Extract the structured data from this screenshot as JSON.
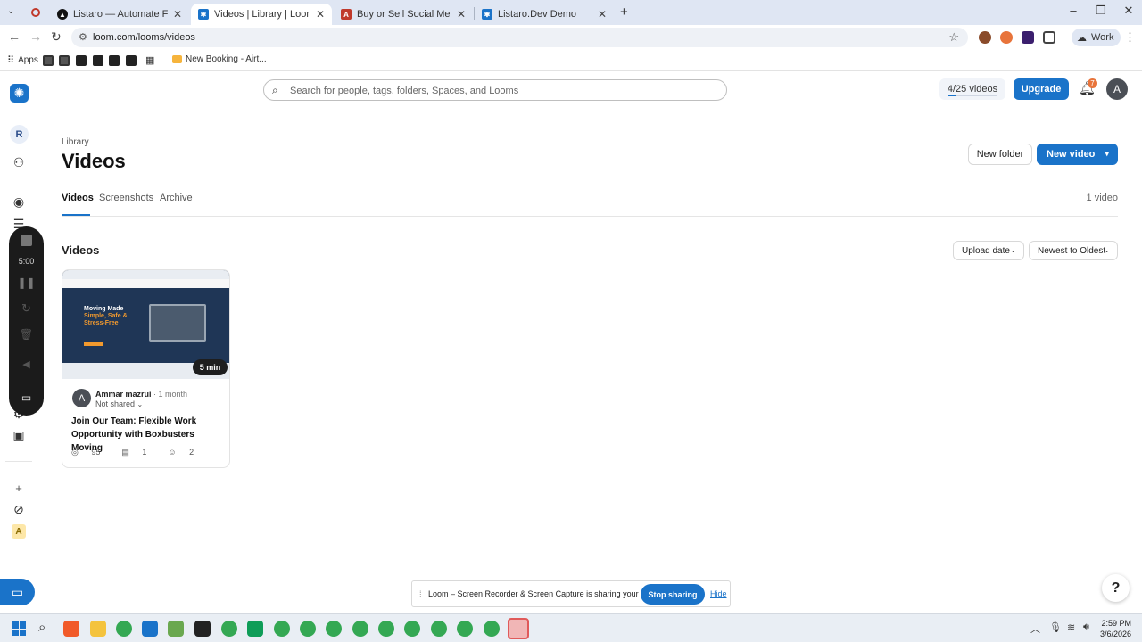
{
  "browser": {
    "tabs": [
      {
        "title": "Listaro — Automate Facebook",
        "active": false
      },
      {
        "title": "Videos | Library | Loom",
        "active": true
      },
      {
        "title": "Buy or Sell Social Media Accou",
        "active": false
      },
      {
        "title": "Listaro.Dev Demo",
        "active": false
      }
    ],
    "url": "loom.com/looms/videos",
    "profile_label": "Work",
    "bookmarks": {
      "apps_label": "Apps",
      "new_booking_label": "New Booking - Airt..."
    }
  },
  "rail": {
    "workspace_initial": "R",
    "member_initial": "A"
  },
  "recorder": {
    "timer": "5:00"
  },
  "header": {
    "search_placeholder": "Search for people, tags, folders, Spaces, and Looms",
    "quota_label": "4/25 videos",
    "quota_fraction": 0.16,
    "upgrade_label": "Upgrade",
    "notification_count": "7",
    "avatar_initial": "A"
  },
  "page": {
    "breadcrumb": "Library",
    "title": "Videos",
    "new_folder_label": "New folder",
    "new_video_label": "New video",
    "tabs": [
      {
        "label": "Videos",
        "active": true
      },
      {
        "label": "Screenshots",
        "active": false
      },
      {
        "label": "Archive",
        "active": false
      }
    ],
    "video_count": "1 video",
    "section_title": "Videos",
    "sort_field": "Upload date",
    "sort_order": "Newest to Oldest"
  },
  "videos": [
    {
      "thumbnail_headline_1": "Moving Made",
      "thumbnail_headline_2": "Simple, Safe &",
      "thumbnail_headline_3": "Stress-Free",
      "duration": "5 min",
      "author_initial": "A",
      "author": "Ammar mazrui",
      "age": "1 month",
      "sharing": "Not shared",
      "title": "Join Our Team: Flexible Work Opportunity with Boxbusters Moving",
      "views": "95",
      "comments": "1",
      "reactions": "2"
    }
  ],
  "sharing_bar": {
    "message": "Loom – Screen Recorder & Screen Capture is sharing your screen.",
    "stop_label": "Stop sharing",
    "hide_label": "Hide"
  },
  "help_label": "?",
  "taskbar": {
    "time": "2:59 PM",
    "date": "3/6/2026"
  },
  "colors": {
    "accent": "#1a73c9",
    "notification_badge": "#e8743b"
  }
}
